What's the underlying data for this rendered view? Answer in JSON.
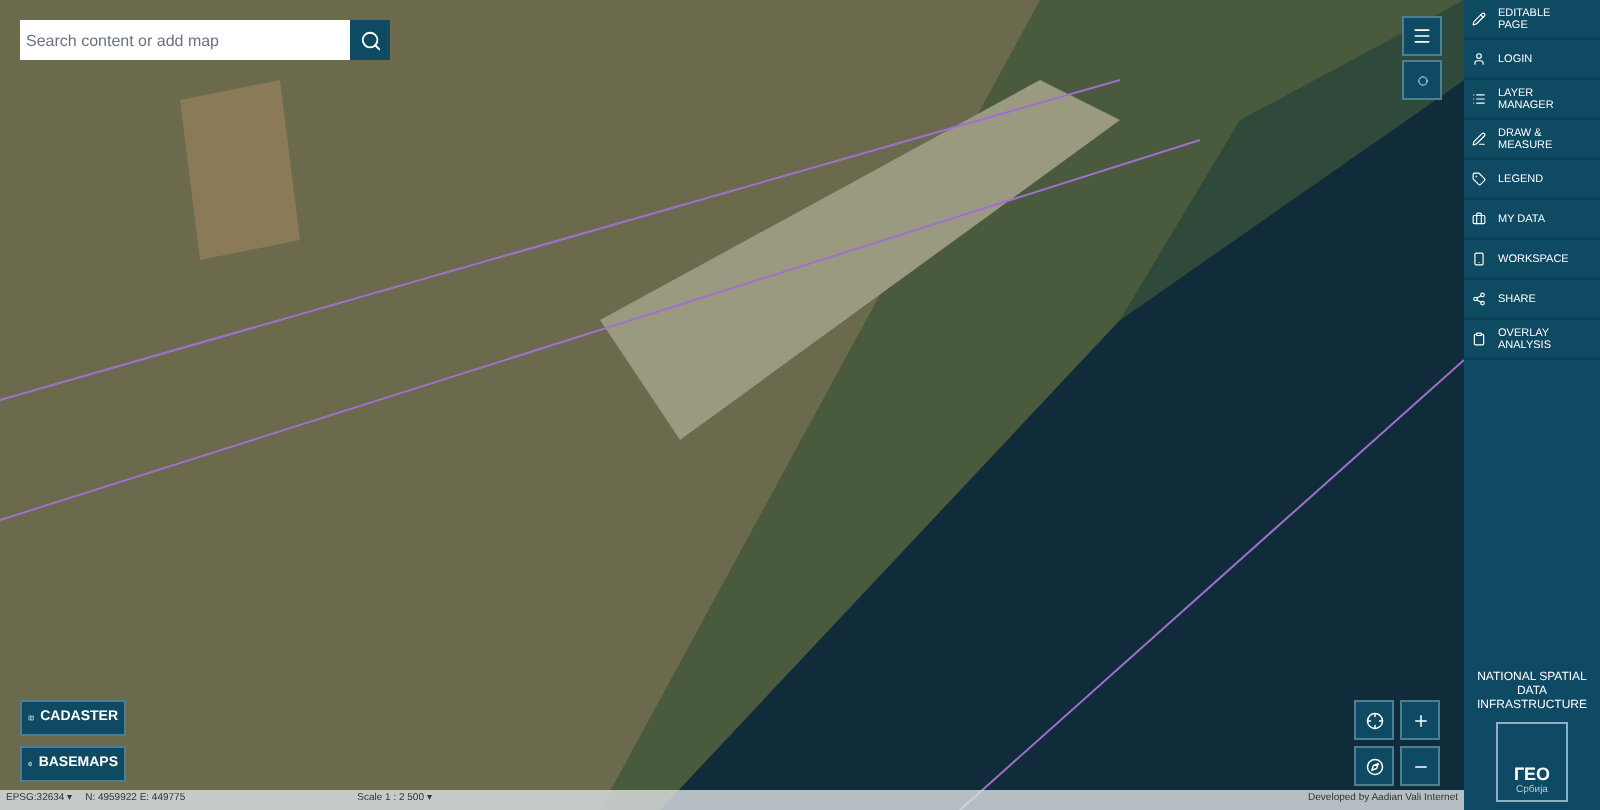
{
  "search": {
    "placeholder": "Search content or add map"
  },
  "sidebar": {
    "items": [
      {
        "kind": "edit",
        "label": "EDITABLE PAGE"
      },
      {
        "kind": "login",
        "label": "LOGIN"
      },
      {
        "kind": "layers",
        "label": "LAYER MANAGER"
      },
      {
        "kind": "draw",
        "label": "DRAW & MEASURE"
      },
      {
        "kind": "legend",
        "label": "LEGEND"
      },
      {
        "kind": "data",
        "label": "MY DATA"
      },
      {
        "kind": "workspace",
        "label": "WORKSPACE"
      },
      {
        "kind": "share",
        "label": "SHARE"
      },
      {
        "kind": "overlay",
        "label": "OVERLAY ANALYSIS"
      }
    ],
    "footer": "NATIONAL SPATIAL DATA INFRASTRUCTURE",
    "logo_text": "ГЕО",
    "logo_subtext": "Србија"
  },
  "map_buttons": [
    {
      "kind": "cadaster",
      "label": "CADASTER"
    },
    {
      "kind": "basemaps",
      "label": "BASEMAPS"
    }
  ],
  "status_bar": {
    "projection": "EPSG:32634 ▾",
    "coordinates": "N: 4959922 E: 449775",
    "scale": "Scale 1 : 2 500 ▾",
    "credit": "Developed by Aadian Vali Internet"
  }
}
